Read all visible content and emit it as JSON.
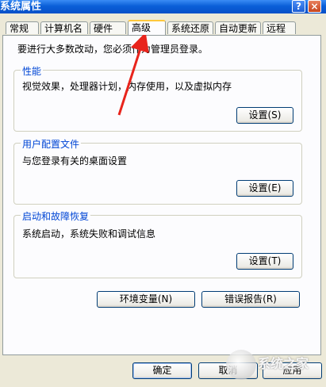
{
  "window": {
    "title": "系统属性",
    "help_label": "?",
    "close_label": "×"
  },
  "tabs": [
    {
      "label": "常规"
    },
    {
      "label": "计算机名"
    },
    {
      "label": "硬件"
    },
    {
      "label": "高级",
      "active": true
    },
    {
      "label": "系统还原"
    },
    {
      "label": "自动更新"
    },
    {
      "label": "远程"
    }
  ],
  "intro": "要进行大多数改动，您必须作为管理员登录。",
  "groups": {
    "performance": {
      "title": "性能",
      "desc": "视觉效果，处理器计划，内存使用，以及虚拟内存",
      "button": "设置(S)"
    },
    "profiles": {
      "title": "用户配置文件",
      "desc": "与您登录有关的桌面设置",
      "button": "设置(E)"
    },
    "startup": {
      "title": "启动和故障恢复",
      "desc": "系统启动，系统失败和调试信息",
      "button": "设置(T)"
    }
  },
  "env_button": "环境变量(N)",
  "error_button": "错误报告(R)",
  "footer": {
    "ok": "确定",
    "cancel": "取消",
    "apply": "应用"
  },
  "watermark": "系统之家",
  "colors": {
    "titlebar": "#0a5fd8",
    "group_title": "#0046d5",
    "arrow": "#e8241c",
    "active_tab_accent": "#ffc83c"
  }
}
